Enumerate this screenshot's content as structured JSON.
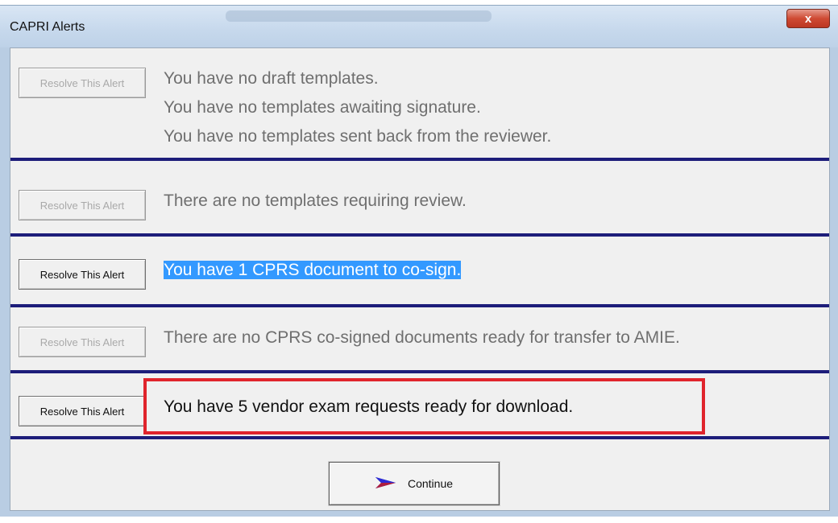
{
  "window": {
    "title": "CAPRI Alerts",
    "close_label": "x"
  },
  "alerts": [
    {
      "button_label": "Resolve This Alert",
      "button_enabled": false,
      "lines": [
        "You have no draft templates.",
        "You have no templates awaiting signature.",
        "You have no templates sent back from the reviewer."
      ]
    },
    {
      "button_label": "Resolve This Alert",
      "button_enabled": false,
      "lines": [
        "There are no templates requiring review."
      ]
    },
    {
      "button_label": "Resolve This Alert",
      "button_enabled": true,
      "lines": [
        "You have 1 CPRS document to co-sign."
      ],
      "selected": true
    },
    {
      "button_label": "Resolve This Alert",
      "button_enabled": false,
      "lines": [
        "There are no CPRS co-signed documents ready for transfer to AMIE."
      ]
    },
    {
      "button_label": "Resolve This Alert",
      "button_enabled": true,
      "lines": [
        "You have 5 vendor exam requests ready for download."
      ],
      "highlighted": true
    }
  ],
  "footer": {
    "continue_label": "Continue",
    "continue_icon": "arrow-right-icon"
  },
  "colors": {
    "separator": "#1d1d7a",
    "highlight_box": "#e0242c",
    "selection": "#3399ff",
    "disabled_text": "#a9a9a9"
  }
}
